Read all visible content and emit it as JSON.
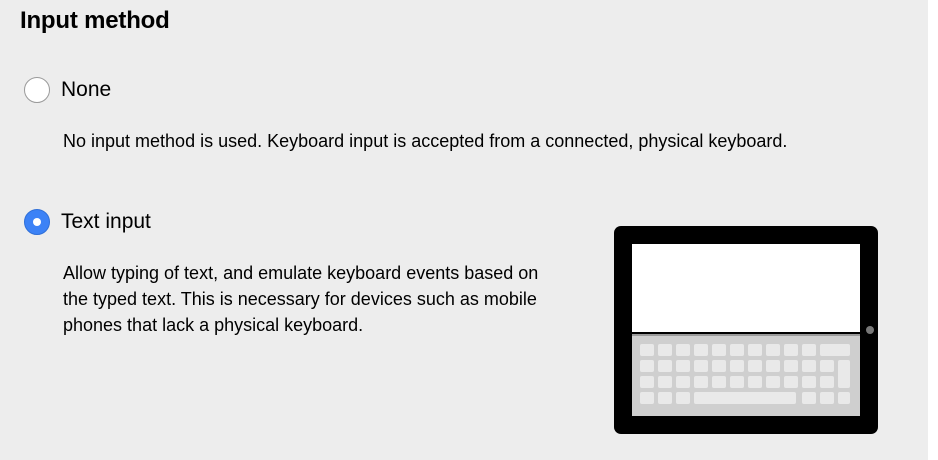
{
  "heading": "Input method",
  "options": [
    {
      "label": "None",
      "selected": false,
      "description": "No input method is used. Keyboard input is accepted from a connected, physical keyboard."
    },
    {
      "label": "Text input",
      "selected": true,
      "description_lines": [
        "Allow typing of text, and emulate keyboard events based on",
        "the typed text. This is necessary for devices such as mobile",
        "phones that lack a physical keyboard."
      ]
    }
  ],
  "illustration": {
    "icon": "tablet-keyboard-icon",
    "key_color": "#e9e9e9",
    "frame_color": "#000000"
  }
}
